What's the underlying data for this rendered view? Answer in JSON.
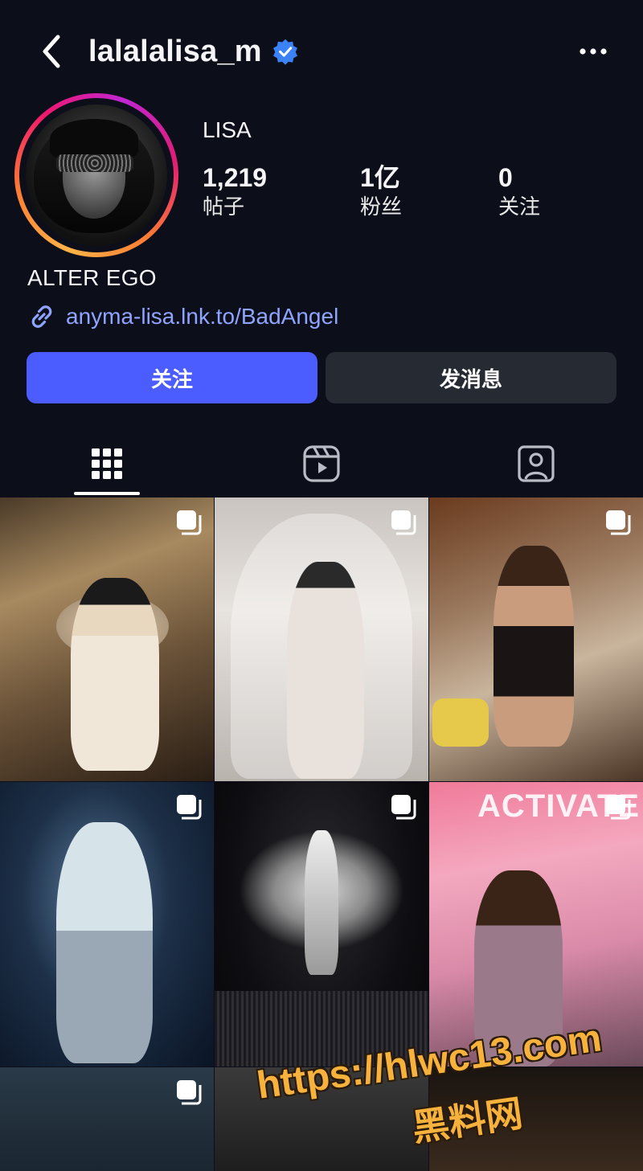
{
  "header": {
    "username": "lalalalisa_m",
    "verified": true,
    "icons": [
      "back-icon",
      "verified-badge-icon",
      "more-icon"
    ]
  },
  "profile": {
    "display_name": "LISA",
    "stats": {
      "posts": {
        "value": "1,219",
        "label": "帖子"
      },
      "followers": {
        "value": "1亿",
        "label": "粉丝"
      },
      "following": {
        "value": "0",
        "label": "关注"
      }
    },
    "bio": "ALTER EGO",
    "link": "anyma-lisa.lnk.to/BadAngel"
  },
  "actions": {
    "follow_label": "关注",
    "message_label": "发消息"
  },
  "tabs": [
    {
      "name": "posts-grid",
      "icon": "grid-icon",
      "active": true
    },
    {
      "name": "reels",
      "icon": "reels-icon",
      "active": false
    },
    {
      "name": "tagged",
      "icon": "tagged-icon",
      "active": false
    }
  ],
  "grid": {
    "post_6_sign": "ACTIVATE"
  },
  "watermark": {
    "url": "https://hlwc13.com",
    "site": "黑料网"
  },
  "colors": {
    "background": "#0c0f1a",
    "accent": "#4b5dff",
    "link": "#8ea4ff",
    "secondary_button": "#262a33",
    "verified": "#3b82f6"
  }
}
